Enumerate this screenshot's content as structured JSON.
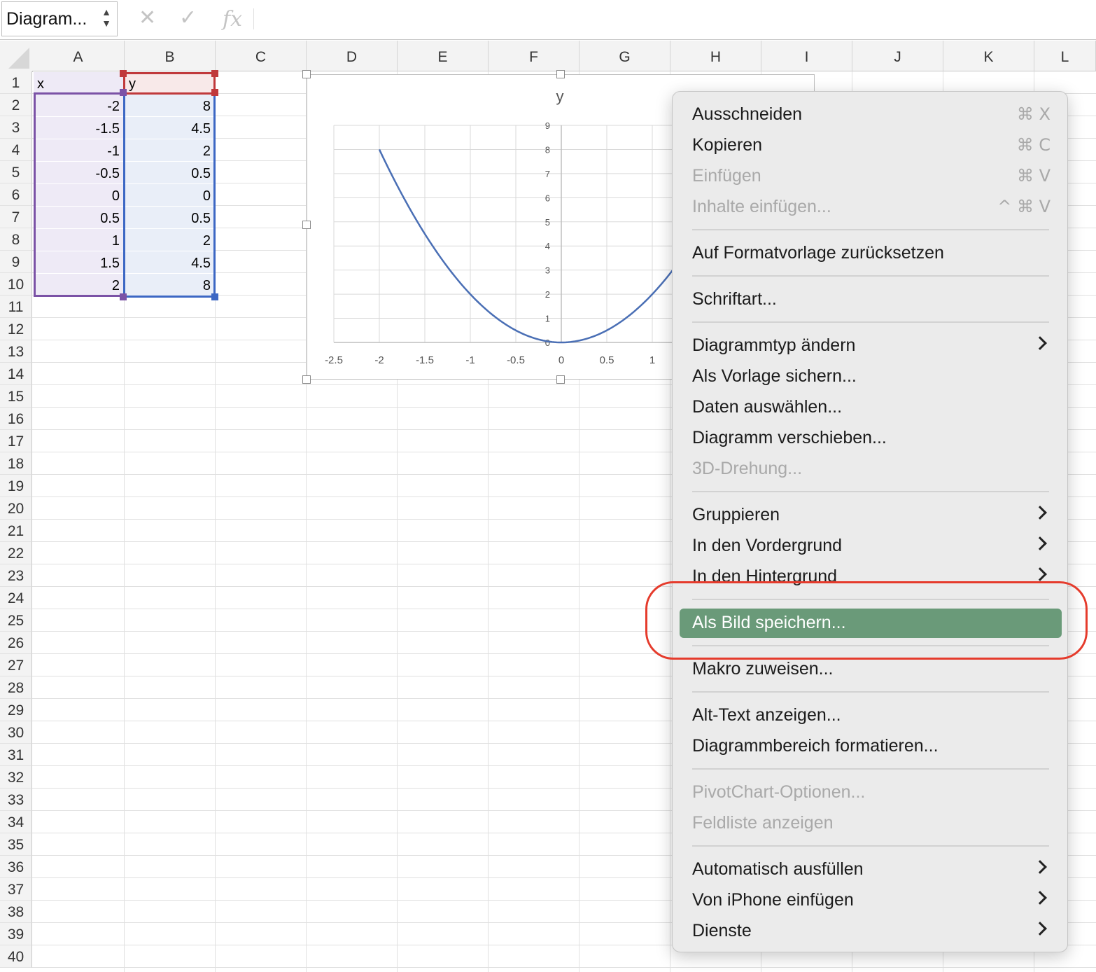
{
  "name_box": {
    "value": "Diagram..."
  },
  "formula_bar": {
    "cancel_icon": "x-mark-icon",
    "confirm_icon": "checkmark-icon",
    "function_label": "fx",
    "value": ""
  },
  "columns": [
    "A",
    "B",
    "C",
    "D",
    "E",
    "F",
    "G",
    "H",
    "I",
    "J",
    "K",
    "L"
  ],
  "rows": [
    "1",
    "2",
    "3",
    "4",
    "5",
    "6",
    "7",
    "8",
    "9",
    "10",
    "11",
    "12",
    "13",
    "14",
    "15",
    "16",
    "17",
    "18",
    "19",
    "20",
    "21",
    "22",
    "23",
    "24",
    "25",
    "26",
    "27",
    "28",
    "29",
    "30",
    "31",
    "32",
    "33",
    "34",
    "35",
    "36",
    "37",
    "38",
    "39",
    "40"
  ],
  "sheet": {
    "header_x": "x",
    "header_y": "y",
    "x_values": [
      "-2",
      "-1.5",
      "-1",
      "-0.5",
      "0",
      "0.5",
      "1",
      "1.5",
      "2"
    ],
    "y_values": [
      "8",
      "4.5",
      "2",
      "0.5",
      "0",
      "0.5",
      "2",
      "4.5",
      "8"
    ]
  },
  "chart_data": {
    "type": "scatter",
    "title": "y",
    "series": [
      {
        "name": "y",
        "x": [
          -2,
          -1.5,
          -1,
          -0.5,
          0,
          0.5,
          1,
          1.5,
          2
        ],
        "y": [
          8,
          4.5,
          2,
          0.5,
          0,
          0.5,
          2,
          4.5,
          8
        ],
        "line": "smooth",
        "color": "#4a6fb5"
      }
    ],
    "x_ticks": [
      "-2.5",
      "-2",
      "-1.5",
      "-1",
      "-0.5",
      "0",
      "0.5",
      "1"
    ],
    "y_ticks": [
      "0",
      "1",
      "2",
      "3",
      "4",
      "5",
      "6",
      "7",
      "8",
      "9"
    ],
    "xlim": [
      -2.5,
      2.5
    ],
    "ylim": [
      0,
      9
    ],
    "grid": true
  },
  "context_menu": {
    "items": [
      {
        "label": "Ausschneiden",
        "shortcut": "⌘ X",
        "enabled": true
      },
      {
        "label": "Kopieren",
        "shortcut": "⌘ C",
        "enabled": true
      },
      {
        "label": "Einfügen",
        "shortcut": "⌘ V",
        "enabled": false
      },
      {
        "label": "Inhalte einfügen...",
        "shortcut": "^ ⌘ V",
        "enabled": false
      },
      {
        "label": "Auf Formatvorlage zurücksetzen",
        "enabled": true
      },
      {
        "label": "Schriftart...",
        "enabled": true
      },
      {
        "label": "Diagrammtyp ändern",
        "enabled": true,
        "submenu": true
      },
      {
        "label": "Als Vorlage sichern...",
        "enabled": true
      },
      {
        "label": "Daten auswählen...",
        "enabled": true
      },
      {
        "label": "Diagramm verschieben...",
        "enabled": true
      },
      {
        "label": "3D-Drehung...",
        "enabled": false
      },
      {
        "label": "Gruppieren",
        "enabled": true,
        "submenu": true
      },
      {
        "label": "In den Vordergrund",
        "enabled": true,
        "submenu": true
      },
      {
        "label": "In den Hintergrund",
        "enabled": true,
        "submenu": true
      },
      {
        "label": "Als Bild speichern...",
        "enabled": true,
        "highlighted": true
      },
      {
        "label": "Makro zuweisen...",
        "enabled": true
      },
      {
        "label": "Alt-Text anzeigen...",
        "enabled": true
      },
      {
        "label": "Diagrammbereich formatieren...",
        "enabled": true
      },
      {
        "label": "PivotChart-Optionen...",
        "enabled": false
      },
      {
        "label": "Feldliste anzeigen",
        "enabled": false
      },
      {
        "label": "Automatisch ausfüllen",
        "enabled": true,
        "submenu": true
      },
      {
        "label": "Von iPhone einfügen",
        "enabled": true,
        "submenu": true
      },
      {
        "label": "Dienste",
        "enabled": true,
        "submenu": true
      }
    ]
  },
  "colors": {
    "highlight": "#6a9a79",
    "annotation": "#e53b2c",
    "series_line": "#4a6fb5",
    "range_x": "#7b52a6",
    "range_y_header": "#c0393b",
    "range_y": "#3c67c4"
  }
}
